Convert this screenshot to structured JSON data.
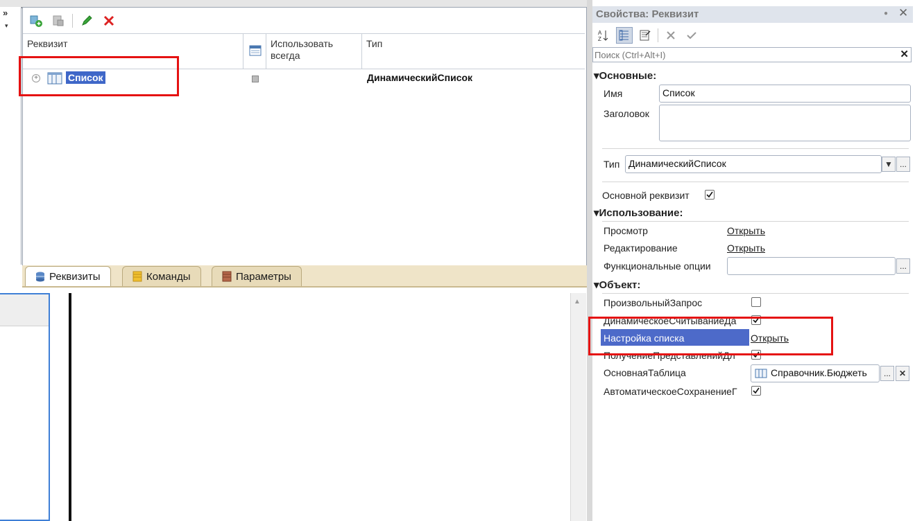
{
  "left_strip": {
    "chevron": "»",
    "arrow": "▾"
  },
  "attributes": {
    "columns": [
      "Реквизит",
      "Использовать всегда",
      "Тип"
    ],
    "rows": [
      {
        "name": "Список",
        "type": "ДинамическийСписок",
        "use_always": false
      }
    ]
  },
  "tabs": [
    {
      "label": "Реквизиты",
      "active": true
    },
    {
      "label": "Команды",
      "active": false
    },
    {
      "label": "Параметры",
      "active": false
    }
  ],
  "properties": {
    "title": "Свойства: Реквизит",
    "search_placeholder": "Поиск (Ctrl+Alt+I)",
    "sections": {
      "main": "Основные:",
      "usage": "Использование:",
      "object": "Объект:"
    },
    "main": {
      "name_label": "Имя",
      "name_value": "Список",
      "caption_label": "Заголовок",
      "caption_value": "",
      "type_label": "Тип",
      "type_value": "ДинамическийСписок",
      "main_attr_label": "Основной реквизит",
      "main_attr_checked": true
    },
    "usage": {
      "view_label": "Просмотр",
      "view_link": "Открыть",
      "edit_label": "Редактирование",
      "edit_link": "Открыть",
      "func_options_label": "Функциональные опции",
      "func_options_value": ""
    },
    "object": {
      "arbitrary_query_label": "ПроизвольныйЗапрос",
      "arbitrary_query_checked": false,
      "dynamic_read_label": "ДинамическоеСчитываниеДа",
      "dynamic_read_checked": true,
      "list_settings_label": "Настройка списка",
      "list_settings_link": "Открыть",
      "get_presentations_label": "ПолучениеПредставленийДл",
      "get_presentations_checked": true,
      "main_table_label": "ОсновнаяТаблица",
      "main_table_value": "Справочник.Бюджеть",
      "auto_save_label": "АвтоматическоеСохранениеГ",
      "auto_save_checked": true
    }
  },
  "colors": {
    "highlight": "#e51212",
    "selection": "#4d6ac9",
    "tab_bg": "#efe4c8"
  }
}
